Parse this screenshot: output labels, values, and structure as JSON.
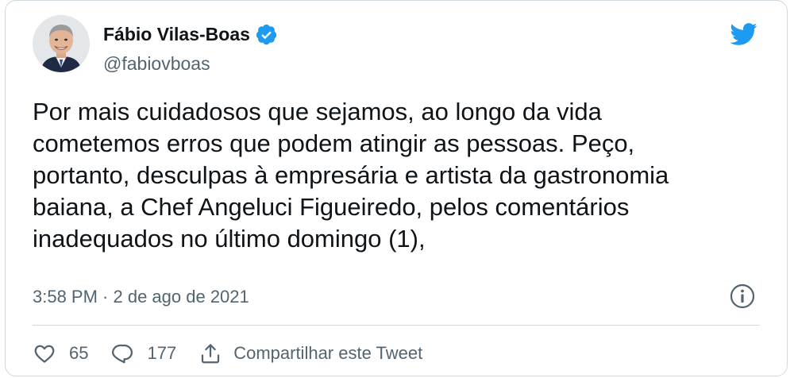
{
  "author": {
    "display_name": "Fábio Vilas-Boas",
    "handle": "@fabiovboas",
    "verified": true
  },
  "tweet": {
    "text": "Por mais cuidadosos que sejamos, ao longo da vida\ncometemos erros que podem atingir as pessoas. Peço,\nportanto, desculpas à empresária e artista da gastronomia\nbaiana, a Chef Angeluci Figueiredo, pelos comentários\ninadequados no último domingo (1),",
    "timestamp": "3:58 PM · 2 de ago de 2021"
  },
  "actions": {
    "like_count": "65",
    "reply_count": "177",
    "share_label": "Compartilhar este Tweet"
  },
  "icons": {
    "brand": "twitter-bird-icon",
    "verified": "verified-badge-icon",
    "info": "info-icon",
    "like": "heart-icon",
    "reply": "reply-bubble-icon",
    "share": "share-icon"
  },
  "colors": {
    "brand_blue": "#1d9bf0",
    "text_primary": "#0f1419",
    "text_secondary": "#536471",
    "border": "#cfd9de"
  }
}
